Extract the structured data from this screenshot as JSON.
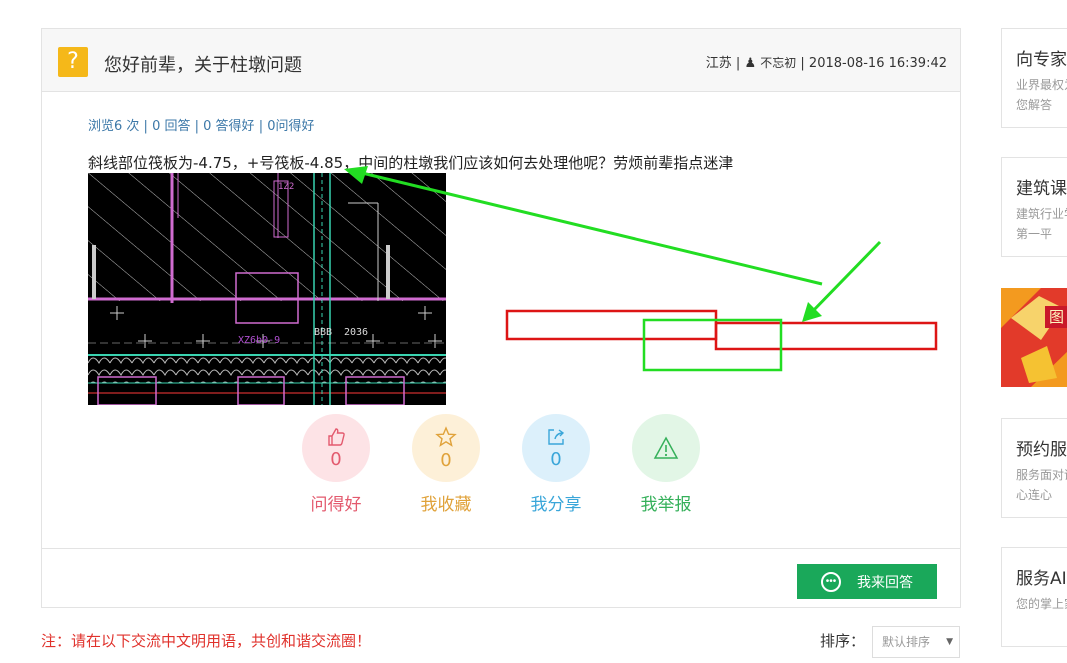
{
  "question": {
    "icon": "question-mark-icon",
    "icon_glyph": "?",
    "title": "您好前辈，关于柱墩问题",
    "region": "江苏",
    "separator": "|",
    "user": "不忘初",
    "datetime": "2018-08-16 16:39:42",
    "stats": {
      "views": "浏览6 次",
      "answers": "0 回答",
      "good_answers": "0 答得好",
      "good_asks": "0问得好",
      "sep": "|"
    },
    "text": "斜线部位筏板为-4.75，+号筏板-4.85，中间的柱墩我们应该如何去处理他呢？劳烦前辈指点迷津",
    "image_labels": [
      "1Z2",
      "BBB",
      "2036",
      "XZ6b0-9"
    ]
  },
  "actions": [
    {
      "id": "like",
      "count": "0",
      "label": "问得好",
      "icon": "thumbs-up-icon",
      "bg": "#fde3e6",
      "color": "#e35a6e"
    },
    {
      "id": "favorite",
      "count": "0",
      "label": "我收藏",
      "icon": "star-icon",
      "bg": "#fdf0d8",
      "color": "#e0a23a"
    },
    {
      "id": "share",
      "count": "0",
      "label": "我分享",
      "icon": "share-icon",
      "bg": "#dcf0fb",
      "color": "#3aa6d9"
    },
    {
      "id": "report",
      "count": "",
      "label": "我举报",
      "icon": "warning-icon",
      "bg": "#e2f6e6",
      "color": "#35b05a"
    }
  ],
  "answer_button": {
    "label": "我来回答",
    "icon": "chat-bubble-icon",
    "glyph": "•••",
    "color": "#1aa85a"
  },
  "note": "注：请在以下交流中文明用语，共创和谐交流圈！",
  "sort": {
    "label": "排序：",
    "selected": "默认排序",
    "arrow": "▼"
  },
  "sidebar": [
    {
      "title": "向专家",
      "desc": "业界最权为您解答"
    },
    {
      "title": "建筑课",
      "desc": "建筑行业学第一平"
    },
    {
      "title": "预约服",
      "desc": "服务面对诺心连心"
    },
    {
      "title": "服务AI",
      "desc": "您的掌上家"
    }
  ],
  "banner": {
    "text": "图"
  }
}
